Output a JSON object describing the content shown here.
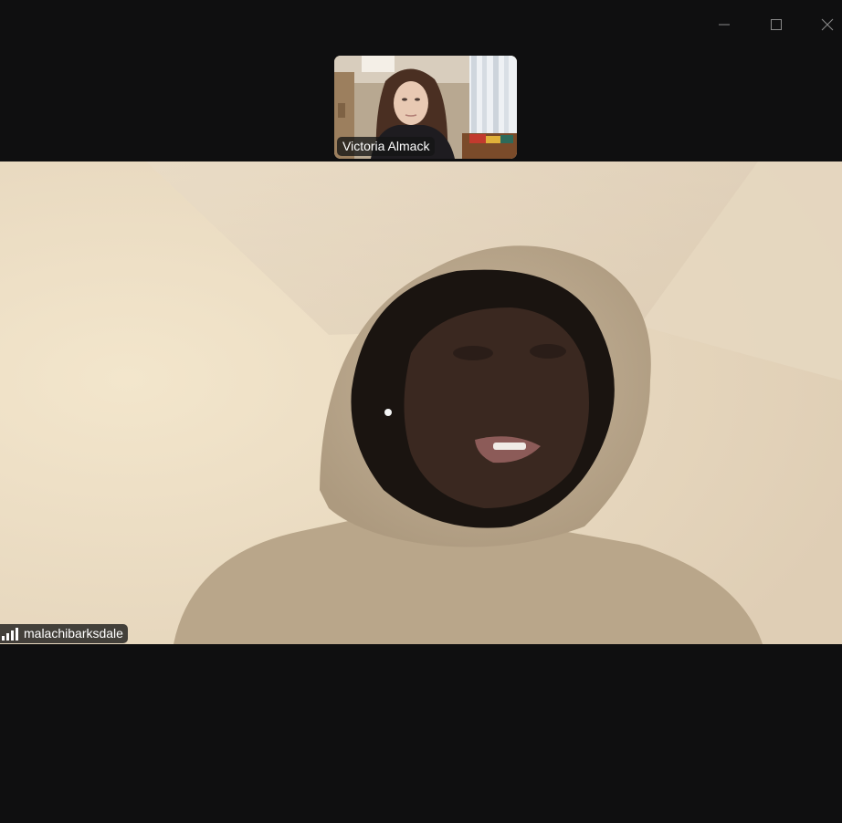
{
  "window": {
    "controls": {
      "minimize_icon": "minimize-icon",
      "maximize_icon": "maximize-icon",
      "close_icon": "close-icon"
    }
  },
  "participants": {
    "thumbnail": {
      "name": "Victoria Almack"
    },
    "main": {
      "name": "malachibarksdale",
      "signal_icon": "network-signal-icon"
    }
  },
  "colors": {
    "background": "#0f0f10",
    "name_tag_bg": "#141414",
    "name_tag_text": "#ffffff",
    "wall": "#eadcc6",
    "hoodie": "#b9a68a"
  }
}
